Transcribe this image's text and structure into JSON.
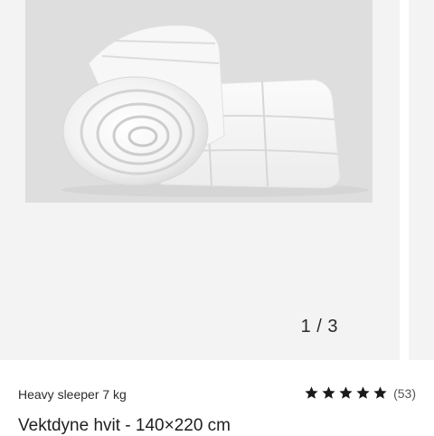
{
  "gallery": {
    "image_alt": "Vektdyne hvit rolled duvet",
    "counter": "1 / 3"
  },
  "product": {
    "brand": "Heavy sleeper 7 kg",
    "rating": {
      "stars": 5,
      "count_label": "(53)"
    },
    "title": "Vektdyne hvit - 140×220 cm"
  },
  "icons": {
    "star": "star-icon"
  },
  "colors": {
    "star": "#1a1a1a",
    "image_bg": "#dedede",
    "slide_bg": "#f3f3f3"
  }
}
